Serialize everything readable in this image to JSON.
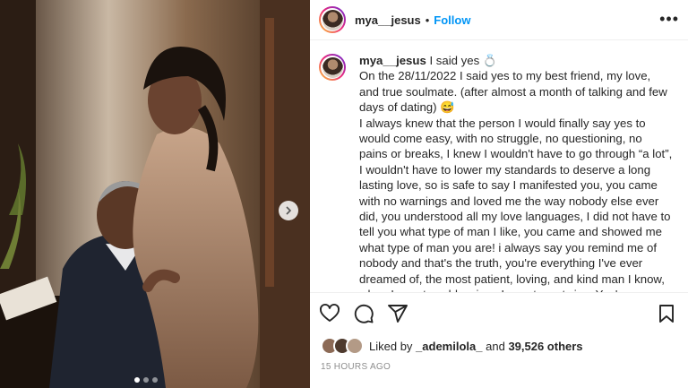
{
  "post": {
    "username": "mya__jesus",
    "separator": "•",
    "follow_label": "Follow",
    "more_icon": "more-horizontal-icon"
  },
  "caption": {
    "username": "mya__jesus",
    "title": "I said yes 💍",
    "lines": [
      "On the 28/11/2022 I said yes to my best friend, my love, and true soulmate. (after almost a month of talking and few days of dating) 😅",
      "I always knew that the person I would finally say yes to would come easy, with no struggle, no questioning, no pains or breaks, I knew I wouldn't have to go through “a lot”, I wouldn't have to lower my standards to deserve a long lasting love, so is safe to say I manifested you, you came with no warnings and loved me the way nobody else ever did, you understood all my love languages, I did not have to tell you what type of man I like, you came and showed me what type of man you are! i always say you remind me of nobody and that's the truth, you're everything I've ever dreamed of, the most patient, loving, and kind man I know, when I count my blessings I count you twice. You're my biggest cheerleader and you always strengthen my faith, I couldn't ask for a more handsome and Godfearing man. the real definition of"
    ]
  },
  "likes": {
    "prefix": "Liked by",
    "user": "_ademilola_",
    "joiner": "and",
    "count": "39,526 others"
  },
  "timestamp": "15 HOURS AGO",
  "carousel": {
    "slides": 3,
    "active": 0
  },
  "colors": {
    "link": "#0095f6",
    "muted": "#8e8e8e",
    "text": "#262626"
  }
}
